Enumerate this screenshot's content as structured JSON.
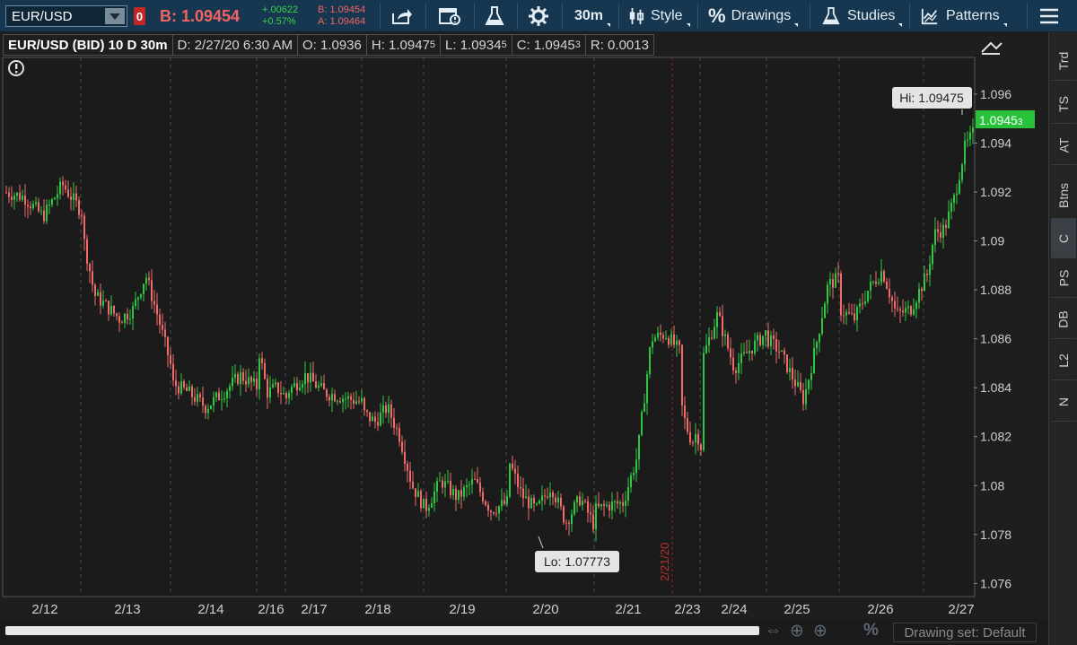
{
  "toolbar": {
    "symbol": "EUR/USD",
    "alert_count": "0",
    "bid_label": "B: 1.09454",
    "net_change": "+.00622",
    "pct_change": "+0.57%",
    "bid_small": "B: 1.09454",
    "ask_small": "A: 1.09464",
    "timeframe": "30m",
    "style_label": "Style",
    "drawings_label": "Drawings",
    "studies_label": "Studies",
    "patterns_label": "Patterns"
  },
  "header": {
    "symbol_desc": "EUR/USD (BID) 10 D 30m",
    "date": "D: 2/27/20 6:30 AM",
    "open": "O: 1.0936",
    "high_main": "H: 1.0947",
    "high_sub": "5",
    "low_main": "L: 1.0934",
    "low_sub": "5",
    "close_main": "C: 1.0945",
    "close_sub": "3",
    "range": "R: 0.0013"
  },
  "right_tabs": [
    "Trd",
    "TS",
    "AT",
    "Btns",
    "C",
    "PS",
    "DB",
    "L2",
    "N"
  ],
  "bottom": {
    "drawing_set": "Drawing set: Default"
  },
  "colors": {
    "up": "#2fc742",
    "down": "#f26b6b",
    "grid": "#4a4a4a",
    "day_divider": "#8a2a2a",
    "last_price_bg": "#27c23a",
    "toolbar_bg": "#16374f"
  },
  "chart_data": {
    "type": "candlestick",
    "symbol": "EUR/USD (BID)",
    "interval": "30m",
    "ylim": [
      1.0755,
      1.0975
    ],
    "y_ticks": [
      "1.096",
      "1.094",
      "1.092",
      "1.09",
      "1.088",
      "1.086",
      "1.084",
      "1.082",
      "1.08",
      "1.078",
      "1.076"
    ],
    "x_labels": [
      "2/12",
      "2/13",
      "2/14",
      "2/16",
      "2/17",
      "2/18",
      "2/19",
      "2/20",
      "2/21",
      "2/23",
      "2/24",
      "2/25",
      "2/26",
      "2/27"
    ],
    "vertical_date_marker": "2/21/20",
    "last_price_main": "1.0945",
    "last_price_sub": "3",
    "high_annotation": "Hi: 1.09475",
    "low_annotation": "Lo: 1.07773",
    "session_closes": [
      {
        "date": "2/12",
        "path": [
          1.092,
          1.0918,
          1.091,
          1.0923,
          1.0912
        ]
      },
      {
        "date": "2/13",
        "path": [
          1.0905,
          1.0878,
          1.0873,
          1.0868,
          1.0872,
          1.0886,
          1.0868,
          1.0848
        ]
      },
      {
        "date": "2/14",
        "path": [
          1.0842,
          1.0838,
          1.0832,
          1.0838,
          1.0845,
          1.084
        ]
      },
      {
        "date": "2/16",
        "path": [
          1.0858,
          1.0838,
          1.084,
          1.0836
        ]
      },
      {
        "date": "2/17",
        "path": [
          1.0838,
          1.0845,
          1.0838,
          1.0836,
          1.0834
        ]
      },
      {
        "date": "2/18",
        "path": [
          1.083,
          1.0826,
          1.0832,
          1.082,
          1.08,
          1.0791
        ]
      },
      {
        "date": "2/19",
        "path": [
          1.079,
          1.0802,
          1.0795,
          1.0802,
          1.079,
          1.0793
        ]
      },
      {
        "date": "2/20",
        "path": [
          1.0812,
          1.0796,
          1.079,
          1.08,
          1.0785,
          1.0795,
          1.0783
        ]
      },
      {
        "date": "2/21",
        "path": [
          1.079,
          1.0792,
          1.0793,
          1.0812,
          1.086,
          1.0862,
          1.0855
        ]
      },
      {
        "date": "2/23",
        "path": [
          1.0838,
          1.0828,
          1.0822,
          1.0818,
          1.0822,
          1.0816
        ]
      },
      {
        "date": "2/24",
        "path": [
          1.085,
          1.087,
          1.0848,
          1.0856,
          1.0863
        ]
      },
      {
        "date": "2/25",
        "path": [
          1.086,
          1.0855,
          1.0845,
          1.0835,
          1.0857,
          1.0882,
          1.0885
        ]
      },
      {
        "date": "2/26",
        "path": [
          1.0872,
          1.0868,
          1.088,
          1.0888,
          1.087,
          1.0872,
          1.0884
        ]
      },
      {
        "date": "2/27",
        "path": [
          1.088,
          1.0903,
          1.0905,
          1.0918,
          1.0938,
          1.0945
        ]
      }
    ]
  }
}
